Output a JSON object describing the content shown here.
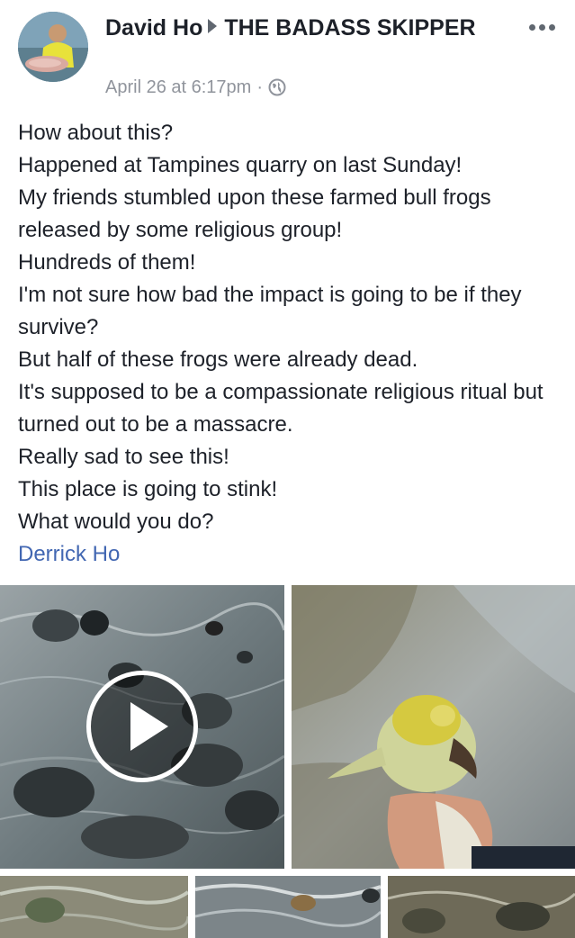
{
  "post": {
    "author": "David Ho",
    "group": "THE BADASS SKIPPER",
    "timestamp": "April 26 at 6:17pm",
    "separator": "·",
    "privacy_icon": "globe-icon",
    "more_icon": "more-options-icon",
    "lines": [
      "How about this?",
      "Happened at Tampines quarry on last Sunday!",
      "My friends stumbled upon these farmed bull frogs released by some religious group!",
      "Hundreds of them!",
      "I'm not sure how bad the impact is going to be if they survive?",
      "But half of these frogs were already dead.",
      "It's supposed to be a compassionate religious ritual but turned out to be a massacre.",
      "Really sad to see this!",
      "This place is going to stink!",
      "What would you do?"
    ],
    "tagged_user": "Derrick Ho"
  },
  "media": {
    "play_icon": "play-icon",
    "colors": {
      "link": "#4267b2",
      "meta": "#90949c",
      "text": "#1d2129"
    }
  }
}
